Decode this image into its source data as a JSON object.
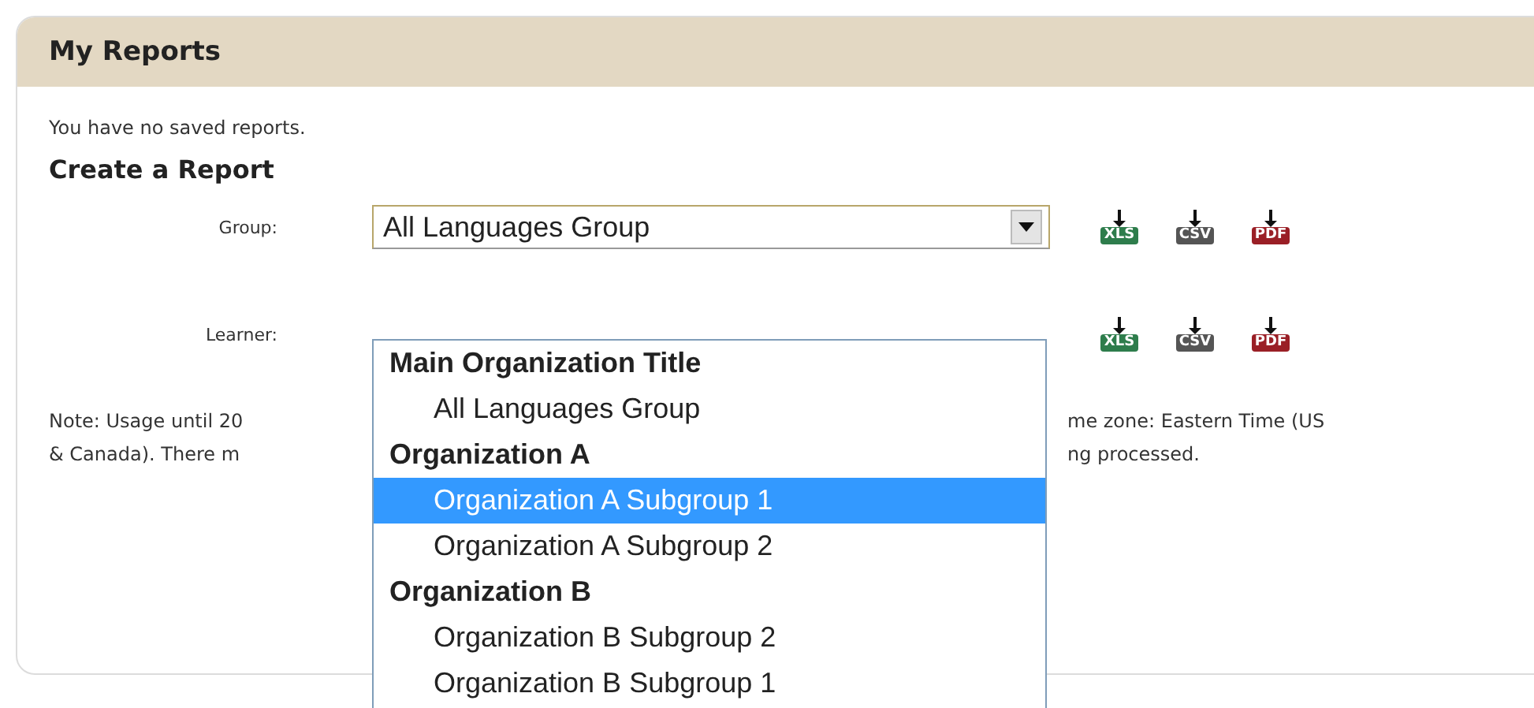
{
  "panel": {
    "title": "My Reports"
  },
  "message": "You have no saved reports.",
  "section_title": "Create a Report",
  "rows": [
    {
      "label": "Group:",
      "value": "All Languages Group",
      "exports": [
        {
          "kind": "xls",
          "label": "XLS"
        },
        {
          "kind": "csv",
          "label": "CSV"
        },
        {
          "kind": "pdf",
          "label": "PDF"
        }
      ]
    },
    {
      "label": "Learner:",
      "exports": [
        {
          "kind": "xls",
          "label": "XLS"
        },
        {
          "kind": "csv",
          "label": "CSV"
        },
        {
          "kind": "pdf",
          "label": "PDF"
        }
      ]
    }
  ],
  "note_lines": [
    {
      "left": "Note: Usage until 20",
      "right": "me zone: Eastern Time (US"
    },
    {
      "left": "& Canada). There m",
      "right": "ng processed."
    }
  ],
  "dropdown": {
    "options": [
      {
        "kind": "group",
        "label": "Main Organization Title",
        "selected": false
      },
      {
        "kind": "option",
        "label": "All Languages Group",
        "selected": false
      },
      {
        "kind": "group",
        "label": "Organization A",
        "selected": false
      },
      {
        "kind": "option",
        "label": "Organization A Subgroup 1",
        "selected": true
      },
      {
        "kind": "option",
        "label": "Organization A Subgroup 2",
        "selected": false
      },
      {
        "kind": "group",
        "label": "Organization B",
        "selected": false
      },
      {
        "kind": "option",
        "label": "Organization B Subgroup 2",
        "selected": false
      },
      {
        "kind": "option",
        "label": "Organization B Subgroup 1",
        "selected": false
      }
    ]
  }
}
